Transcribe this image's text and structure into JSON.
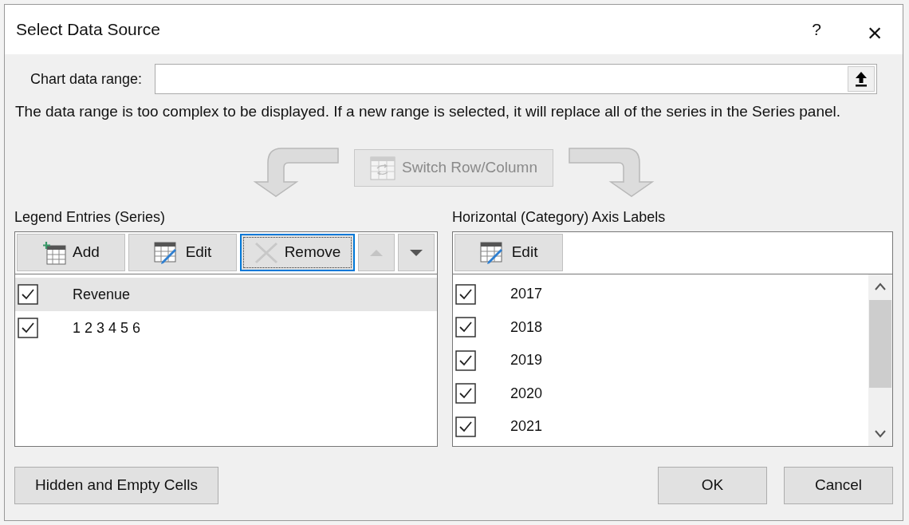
{
  "window": {
    "title": "Select Data Source",
    "help": "?",
    "close": "×"
  },
  "chart_data_range": {
    "label": "Chart data range:"
  },
  "message": "The data range is too complex to be displayed. If a new range is selected, it will replace all of the series in the Series panel.",
  "switch_button": {
    "label": "Switch Row/Column",
    "disabled": true
  },
  "legend_entries": {
    "title": "Legend Entries (Series)",
    "buttons": [
      {
        "kind": "add",
        "label": "Add",
        "disabled": false,
        "focused": false
      },
      {
        "kind": "edit",
        "label": "Edit",
        "disabled": false,
        "focused": false
      },
      {
        "kind": "remove",
        "label": "Remove",
        "disabled": false,
        "focused": true
      },
      {
        "kind": "up",
        "disabled": true,
        "focused": false
      },
      {
        "kind": "down",
        "disabled": false,
        "focused": false
      }
    ],
    "items": [
      {
        "label": "Revenue",
        "checked": true,
        "selected": true
      },
      {
        "label": "1 2 3 4 5 6",
        "checked": true,
        "selected": false
      }
    ]
  },
  "axis_labels": {
    "title": "Horizontal (Category) Axis Labels",
    "edit_button": {
      "label": "Edit",
      "disabled": false
    },
    "items": [
      {
        "label": "2017",
        "checked": true
      },
      {
        "label": "2018",
        "checked": true
      },
      {
        "label": "2019",
        "checked": true
      },
      {
        "label": "2020",
        "checked": true
      },
      {
        "label": "2021",
        "checked": true
      }
    ]
  },
  "footer": {
    "hidden_cells_button": "Hidden and Empty Cells",
    "ok_button": "OK",
    "cancel_button": "Cancel"
  }
}
